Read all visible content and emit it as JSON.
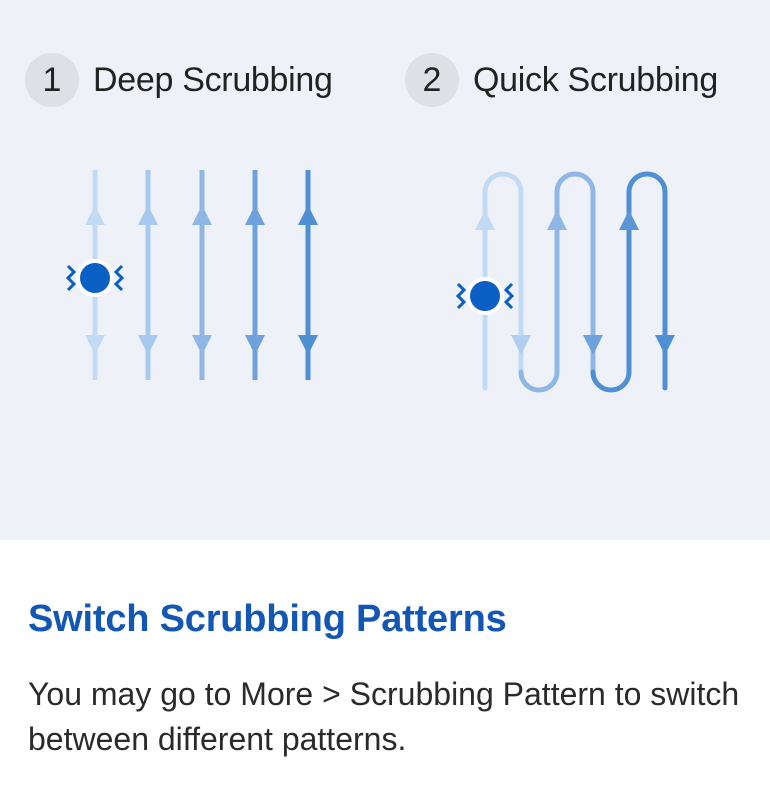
{
  "patterns": [
    {
      "number": "1",
      "title": "Deep Scrubbing"
    },
    {
      "number": "2",
      "title": "Quick Scrubbing"
    }
  ],
  "info": {
    "heading": "Switch Scrubbing Patterns",
    "description": "You may go to More > Scrubbing Pattern to switch between different patterns."
  },
  "colors": {
    "heading": "#1257b3",
    "path_light": "#b9d3f1",
    "path_mid": "#8fb7e6",
    "path_dark": "#4f8fd4",
    "robot_dot": "#0a5fc4"
  },
  "icons": [
    "scrub-path-icon",
    "robot-position-icon"
  ]
}
